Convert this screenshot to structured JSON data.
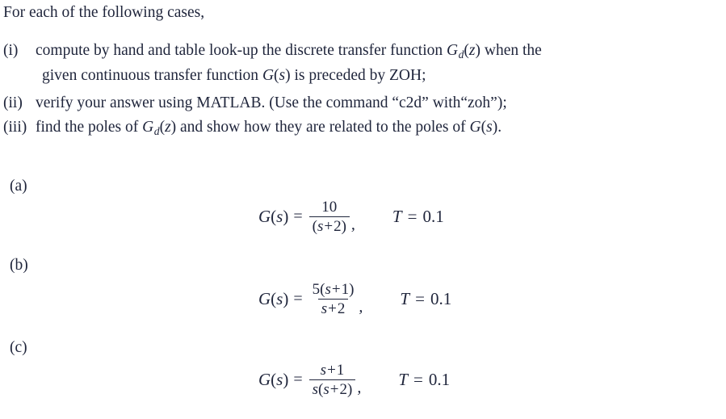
{
  "document": {
    "intro": "For each of the following cases,",
    "text_color": "#20263c",
    "background_color": "#ffffff"
  },
  "instructions": [
    {
      "marker": "(i)",
      "line1_before_math": "compute by hand and table look-up the discrete transfer function ",
      "math1": {
        "fn": "G",
        "sub": "d",
        "open": "(",
        "arg": "z",
        "close": ")"
      },
      "line1_after_math": " when the",
      "line2_before_math": "given continuous transfer function ",
      "math2": {
        "fn": "G",
        "sub": "",
        "open": "(",
        "arg": "s",
        "close": ")"
      },
      "line2_after_math": " is preceded by ZOH;"
    },
    {
      "marker": "(ii)",
      "line1_before_math": "verify your answer using MATLAB. (Use the command  “c2d”  with“zoh”);",
      "math1": null,
      "line1_after_math": ""
    },
    {
      "marker": "(iii)",
      "line1_before_math": "find the poles of ",
      "math1": {
        "fn": "G",
        "sub": "d",
        "open": "(",
        "arg": "z",
        "close": ")"
      },
      "line1_middle": " and show how they are related to the poles of ",
      "math2": {
        "fn": "G",
        "sub": "",
        "open": "(",
        "arg": "s",
        "close": ")"
      },
      "line1_after_math": "."
    }
  ],
  "cases": [
    {
      "label": "(a)",
      "lhs": {
        "fn": "G",
        "open": "(",
        "arg": "s",
        "close": ")"
      },
      "equals": "=",
      "numerator": "10",
      "denominator": "(s + 2)",
      "denominator_parts": {
        "open": "(",
        "var": "s",
        "op": "+",
        "num": "2",
        "close": ")"
      },
      "comma": ",",
      "period_symbol": "T",
      "period_equals": "=",
      "period_value": "0.1"
    },
    {
      "label": "(b)",
      "lhs": {
        "fn": "G",
        "open": "(",
        "arg": "s",
        "close": ")"
      },
      "equals": "=",
      "numerator": "5(s + 1)",
      "numerator_parts": {
        "coef": "5",
        "open": "(",
        "var": "s",
        "op": "+",
        "num": "1",
        "close": ")"
      },
      "denominator": "s + 2",
      "denominator_parts": {
        "var": "s",
        "op": "+",
        "num": "2"
      },
      "comma": ",",
      "period_symbol": "T",
      "period_equals": "=",
      "period_value": "0.1"
    },
    {
      "label": "(c)",
      "lhs": {
        "fn": "G",
        "open": "(",
        "arg": "s",
        "close": ")"
      },
      "equals": "=",
      "numerator": "s + 1",
      "numerator_parts": {
        "var": "s",
        "op": "+",
        "num": "1"
      },
      "denominator": "s(s + 2)",
      "denominator_parts": {
        "outer_var": "s",
        "open": "(",
        "var": "s",
        "op": "+",
        "num": "2",
        "close": ")"
      },
      "comma": ",",
      "period_symbol": "T",
      "period_equals": "=",
      "period_value": "0.1"
    }
  ]
}
